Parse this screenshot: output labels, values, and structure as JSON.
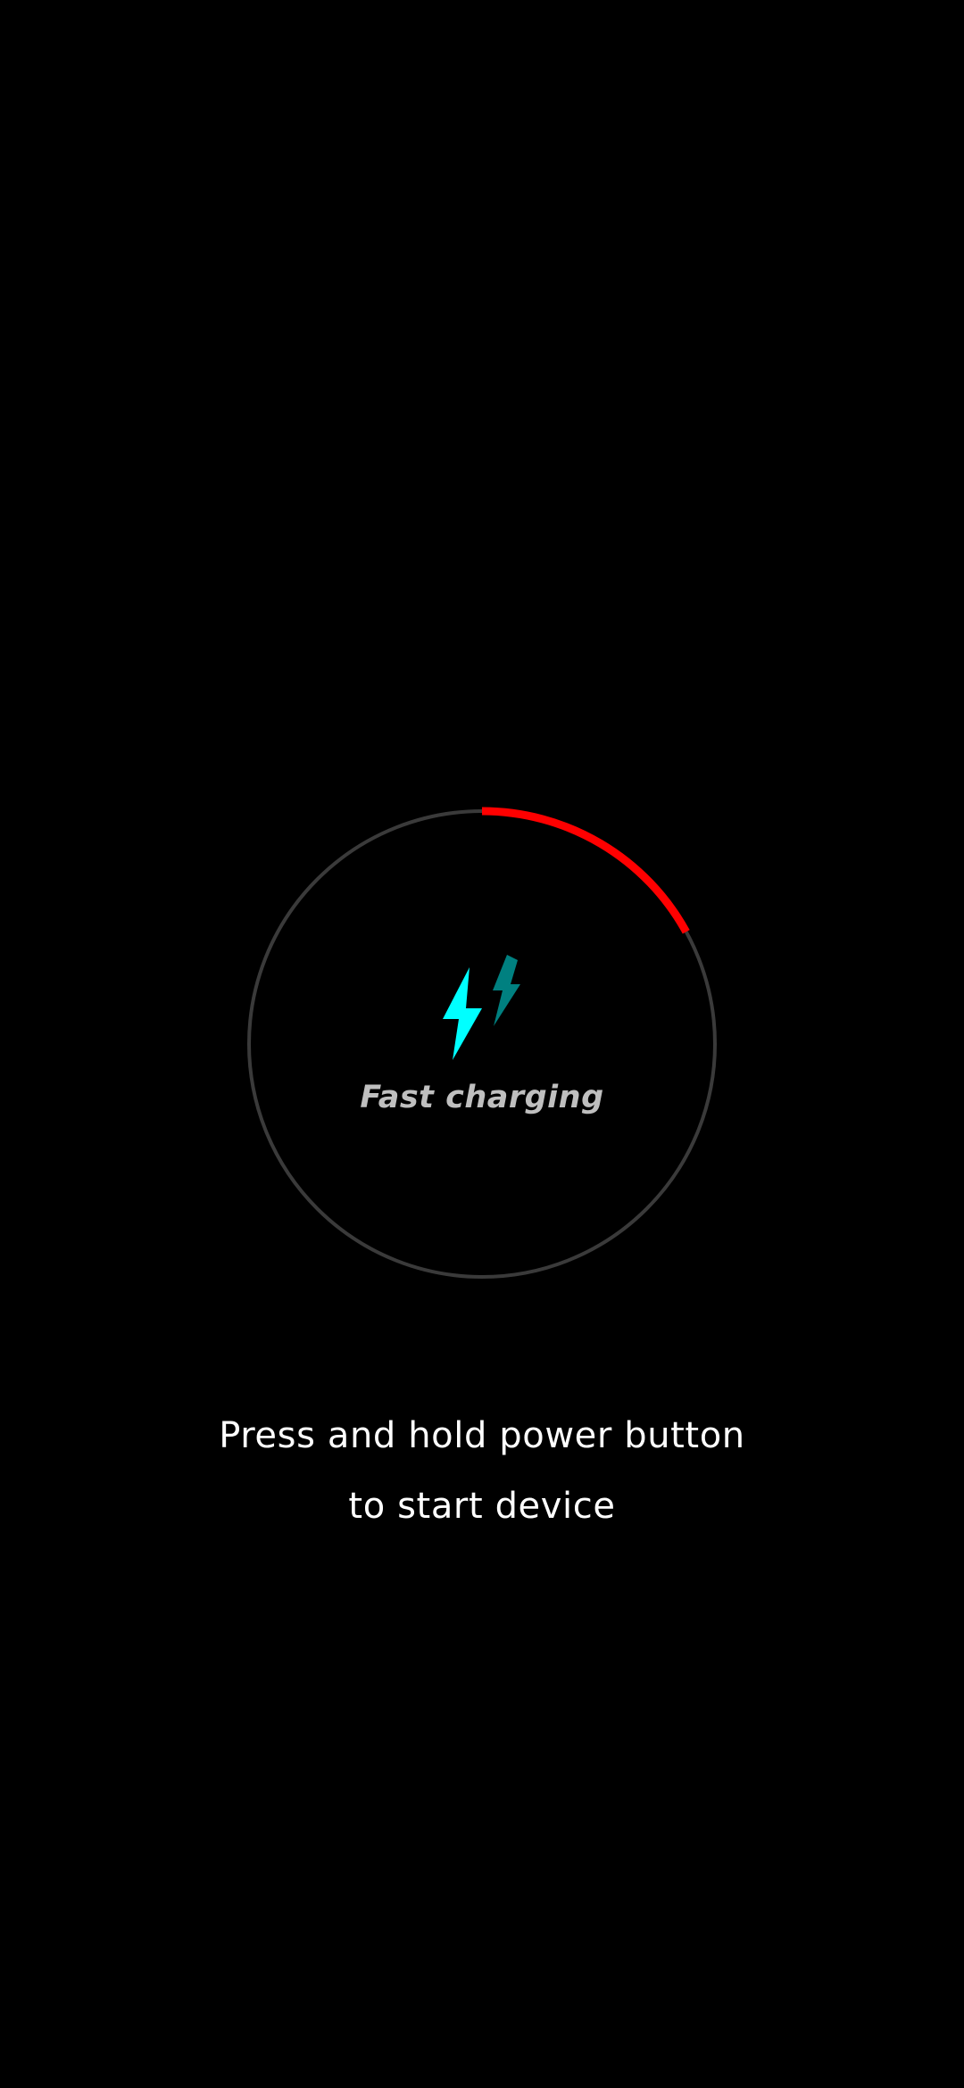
{
  "charging": {
    "status_label": "Fast charging",
    "battery_level_fraction": 0.17,
    "colors": {
      "progress_arc": "#ff0000",
      "ring_track": "#3a3a3a",
      "bolt_primary": "#00ffff",
      "bolt_secondary": "#008080"
    },
    "icon": "fast-charging-bolt-icon"
  },
  "hint": {
    "line1": "Press and hold power button",
    "line2": "to start device"
  }
}
